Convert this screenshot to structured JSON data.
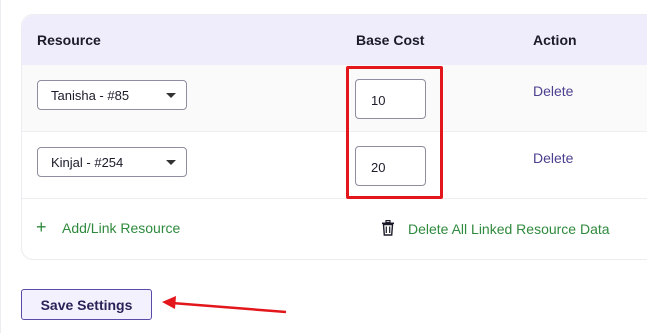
{
  "table": {
    "columns": {
      "resource": "Resource",
      "base_cost": "Base Cost",
      "action": "Action"
    },
    "rows": [
      {
        "resource": "Tanisha - #85",
        "base_cost": "10",
        "action": "Delete"
      },
      {
        "resource": "Kinjal - #254",
        "base_cost": "20",
        "action": "Delete"
      }
    ]
  },
  "footer": {
    "add_label": "Add/Link Resource",
    "delete_all_label": "Delete All Linked Resource Data"
  },
  "save_label": "Save Settings",
  "colors": {
    "accent": "#4d3f8f",
    "green": "#2f8a3d",
    "annotation": "#e3161b",
    "header_bg": "#efedfb"
  },
  "icons": {
    "plus": "plus-icon",
    "trash": "trash-icon",
    "caret": "chevron-down-icon"
  }
}
